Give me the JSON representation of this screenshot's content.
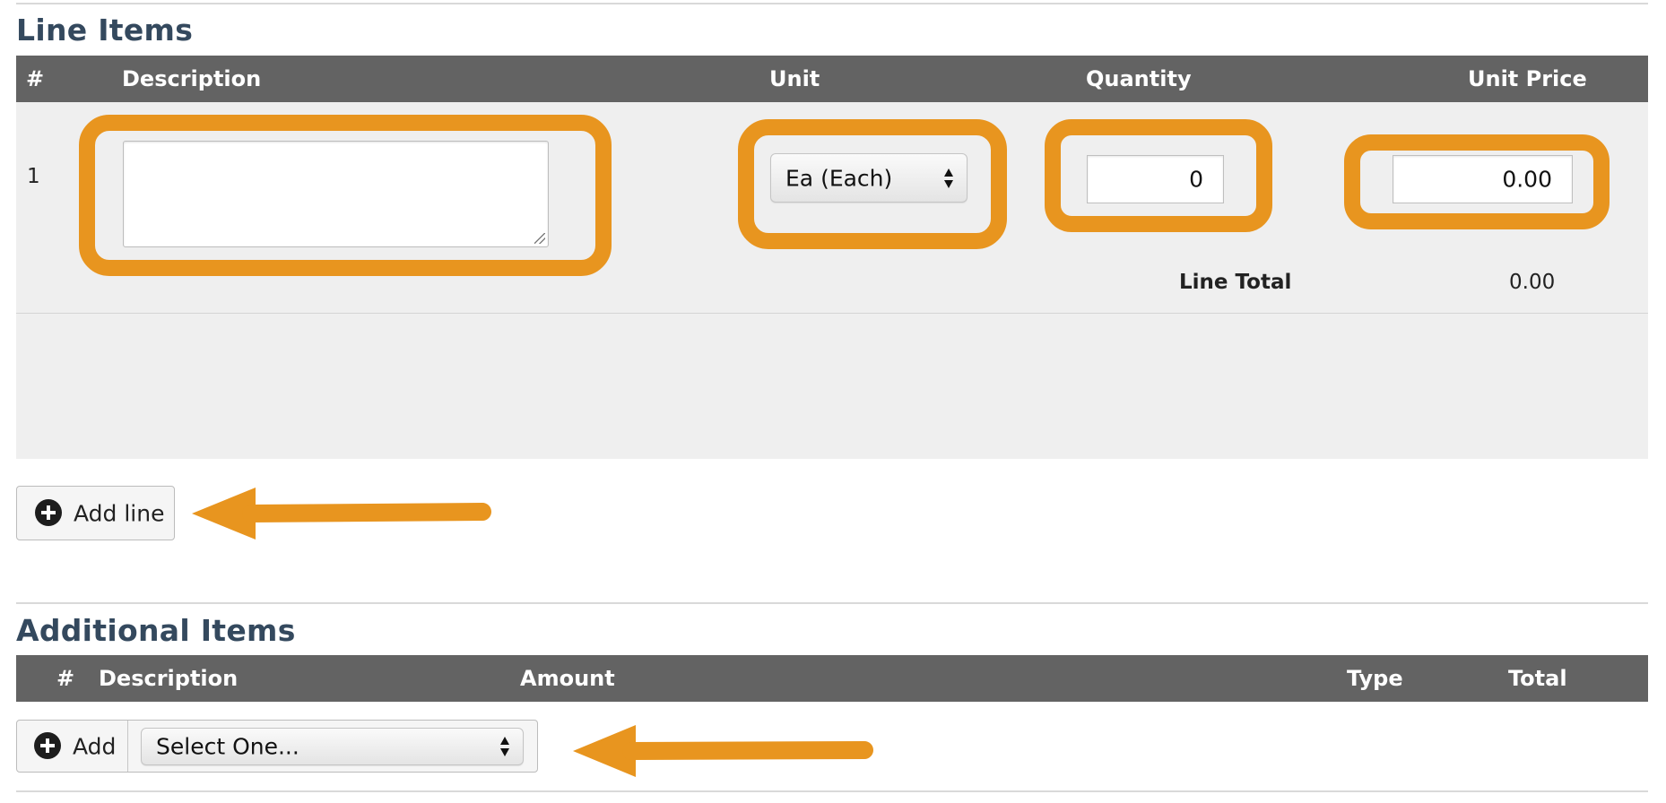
{
  "line_items": {
    "title": "Line Items",
    "headers": {
      "num": "#",
      "description": "Description",
      "unit": "Unit",
      "quantity": "Quantity",
      "unit_price": "Unit Price"
    },
    "rows": [
      {
        "num": "1",
        "description": "",
        "unit": "Ea (Each)",
        "quantity": "0",
        "unit_price": "0.00",
        "line_total_label": "Line Total",
        "line_total": "0.00"
      }
    ],
    "add_line_label": "Add line"
  },
  "additional_items": {
    "title": "Additional Items",
    "headers": {
      "num": "#",
      "description": "Description",
      "amount": "Amount",
      "type": "Type",
      "total": "Total"
    },
    "add_label": "Add",
    "select_value": "Select One..."
  },
  "annotations": {
    "highlight_color": "#e8951f",
    "icons": [
      "plus-circle-icon",
      "select-arrows-icon",
      "resize-grip-icon",
      "arrow-left-icon"
    ]
  }
}
